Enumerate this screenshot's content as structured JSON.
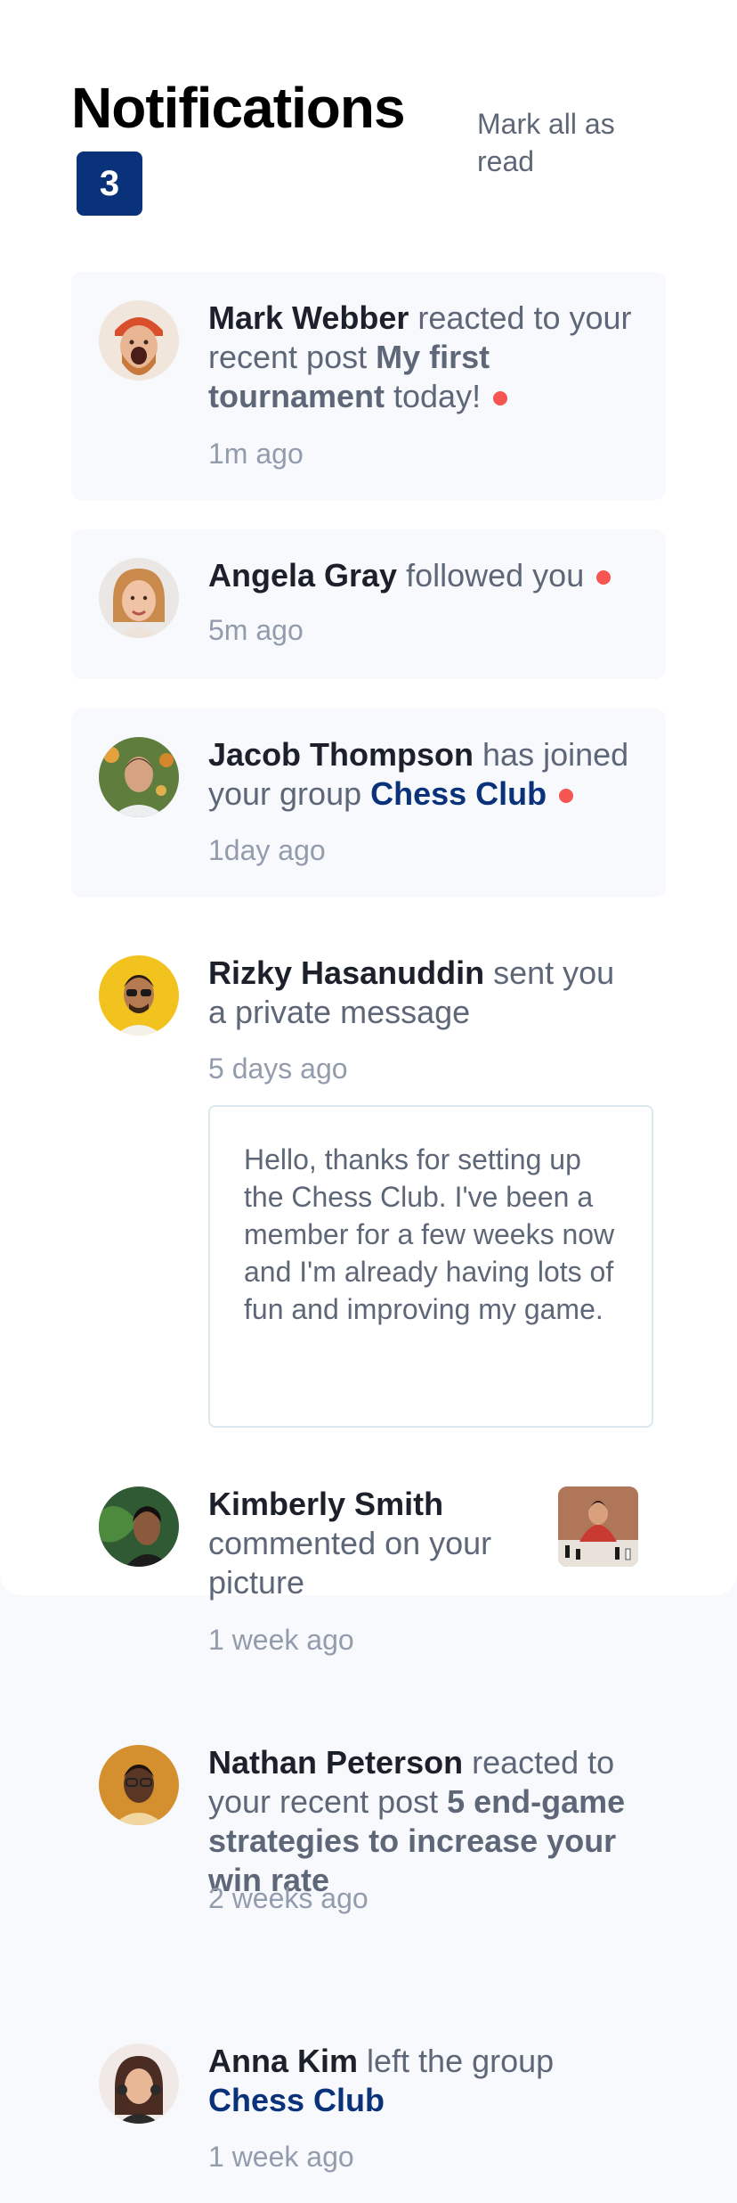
{
  "header": {
    "title": "Notifications",
    "unread_count": "3",
    "mark_all_label": "Mark all as read"
  },
  "notifications": [
    {
      "name": "Mark Webber",
      "action": " reacted to your recent post ",
      "post": "My first tournament",
      "suffix": " today!",
      "time": "1m ago",
      "unread": true
    },
    {
      "name": "Angela Gray",
      "action": " followed you",
      "time": "5m ago",
      "unread": true
    },
    {
      "name": "Jacob Thompson",
      "action": " has joined your group ",
      "group": "Chess Club",
      "time": "1day ago",
      "unread": true
    },
    {
      "name": "Rizky Hasanuddin",
      "action": " sent you a private message",
      "time": "5 days ago",
      "message": "Hello, thanks for setting up the Chess Club. I've been a member for a few weeks now and I'm already having lots of fun and improving my game.",
      "unread": false
    },
    {
      "name": "Kimberly Smith",
      "action": " commented on your picture",
      "time": "1 week ago",
      "unread": false
    },
    {
      "name": "Nathan Peterson",
      "action": " reacted to your recent post ",
      "post": "5 end-game strategies to increase your win rate",
      "time": "2 weeks ago",
      "unread": false
    },
    {
      "name": "Anna Kim",
      "action": " left the group ",
      "group": "Chess Club",
      "time": "1 week ago",
      "unread": false
    }
  ],
  "colors": {
    "accent_blue": "#0a327b",
    "unread_dot": "#f65552",
    "unread_bg": "#f7f9fd",
    "text_muted": "#5e6778",
    "text_time": "#939cad"
  }
}
